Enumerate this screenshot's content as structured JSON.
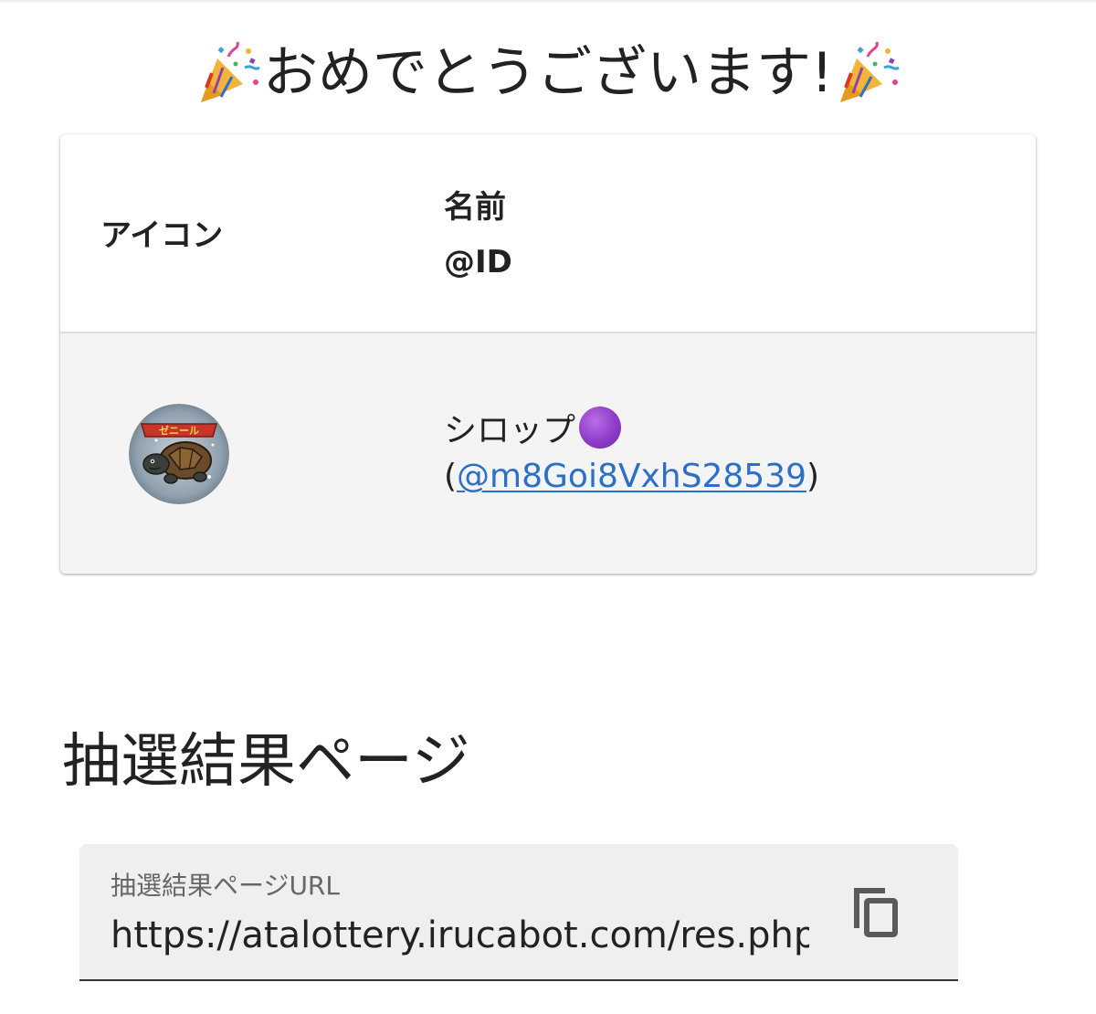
{
  "title": {
    "text": "おめでとうございます!",
    "left_icon": "party-popper-icon",
    "right_icon": "party-popper-icon"
  },
  "winner_table": {
    "headers": {
      "icon": "アイコン",
      "name": "名前",
      "id": "@ID"
    },
    "rows": [
      {
        "avatar": "turtle-avatar",
        "avatar_text": "ゼニール",
        "name": "シロップ",
        "name_emoji": "purple-circle-icon",
        "id_prefix": "(",
        "id": "@m8Goi8VxhS28539",
        "id_suffix": ")"
      }
    ]
  },
  "results_section": {
    "heading": "抽選結果ページ",
    "url_field": {
      "label": "抽選結果ページURL",
      "value": "https://atalottery.irucabot.com/res.php",
      "action_icon": "copy-icon"
    }
  },
  "colors": {
    "link": "#2a6fc9",
    "row_background": "#f4f4f4",
    "field_background": "#efefef",
    "text": "#222222"
  }
}
